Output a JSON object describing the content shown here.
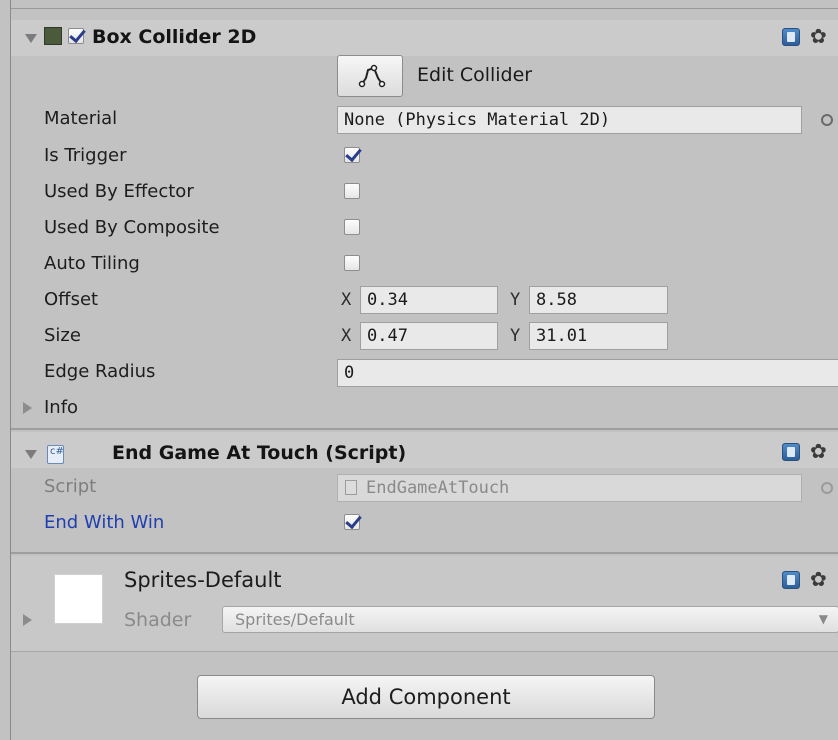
{
  "box_collider": {
    "title": "Box Collider 2D",
    "enabled": true,
    "edit_collider_label": "Edit Collider",
    "properties": {
      "material_label": "Material",
      "material_value": "None (Physics Material 2D)",
      "is_trigger_label": "Is Trigger",
      "is_trigger": true,
      "used_by_effector_label": "Used By Effector",
      "used_by_effector": false,
      "used_by_composite_label": "Used By Composite",
      "used_by_composite": false,
      "auto_tiling_label": "Auto Tiling",
      "auto_tiling": false,
      "offset_label": "Offset",
      "offset_x": "0.34",
      "offset_y": "8.58",
      "size_label": "Size",
      "size_x": "0.47",
      "size_y": "31.01",
      "edge_radius_label": "Edge Radius",
      "edge_radius": "0",
      "info_label": "Info",
      "x_letter": "X",
      "y_letter": "Y"
    }
  },
  "script_component": {
    "title": "End Game At Touch (Script)",
    "script_label": "Script",
    "script_value": "EndGameAtTouch",
    "end_with_win_label": "End With Win",
    "end_with_win": true
  },
  "material": {
    "name": "Sprites-Default",
    "shader_label": "Shader",
    "shader_value": "Sprites/Default"
  },
  "add_component_label": "Add Component",
  "icons": {
    "help": "help-book-icon",
    "settings": "gear-icon",
    "script": "csharp-script-icon",
    "edit_collider": "polygon-edit-icon"
  },
  "colors": {
    "panel_bg": "#c2c2c2",
    "checkmark": "#2a3d8a",
    "highlight_label": "#1f3fb0"
  }
}
